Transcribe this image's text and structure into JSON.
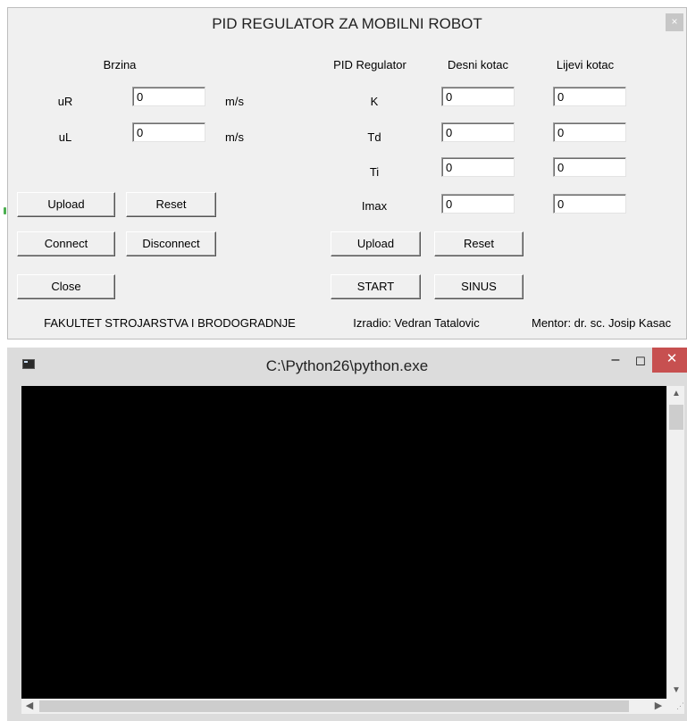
{
  "pid_window": {
    "title": "PID REGULATOR ZA MOBILNI ROBOT",
    "close_glyph": "×",
    "speed": {
      "header": "Brzina",
      "uR_label": "uR",
      "uR_value": "0",
      "uR_unit": "m/s",
      "uL_label": "uL",
      "uL_value": "0",
      "uL_unit": "m/s"
    },
    "left_buttons": {
      "upload": "Upload",
      "reset": "Reset",
      "connect": "Connect",
      "disconnect": "Disconnect",
      "close": "Close"
    },
    "pid": {
      "header": "PID Regulator",
      "right_header": "Desni kotac",
      "left_header": "Lijevi kotac",
      "rows": [
        {
          "label": "K",
          "right": "0",
          "left": "0"
        },
        {
          "label": "Td",
          "right": "0",
          "left": "0"
        },
        {
          "label": "Ti",
          "right": "0",
          "left": "0"
        },
        {
          "label": "Imax",
          "right": "0",
          "left": "0"
        }
      ]
    },
    "pid_buttons": {
      "upload": "Upload",
      "reset": "Reset",
      "start": "START",
      "sinus": "SINUS"
    },
    "footer": {
      "faculty": "FAKULTET STROJARSTVA I BRODOGRADNJE",
      "author": "Izradio: Vedran Tatalovic",
      "mentor": "Mentor: dr. sc. Josip Kasac"
    }
  },
  "console_window": {
    "title": "C:\\Python26\\python.exe",
    "minimize_glyph": "–",
    "maximize_glyph": "☐",
    "close_glyph": "✕",
    "scroll_up": "▲",
    "scroll_down": "▼",
    "scroll_left": "◀",
    "scroll_right": "▶"
  },
  "icons": {
    "console_app_icon": "console-icon",
    "close": "close-icon"
  },
  "colors": {
    "window_bg": "#f0f0f0",
    "console_bg": "#000000",
    "close_red": "#c75050"
  }
}
